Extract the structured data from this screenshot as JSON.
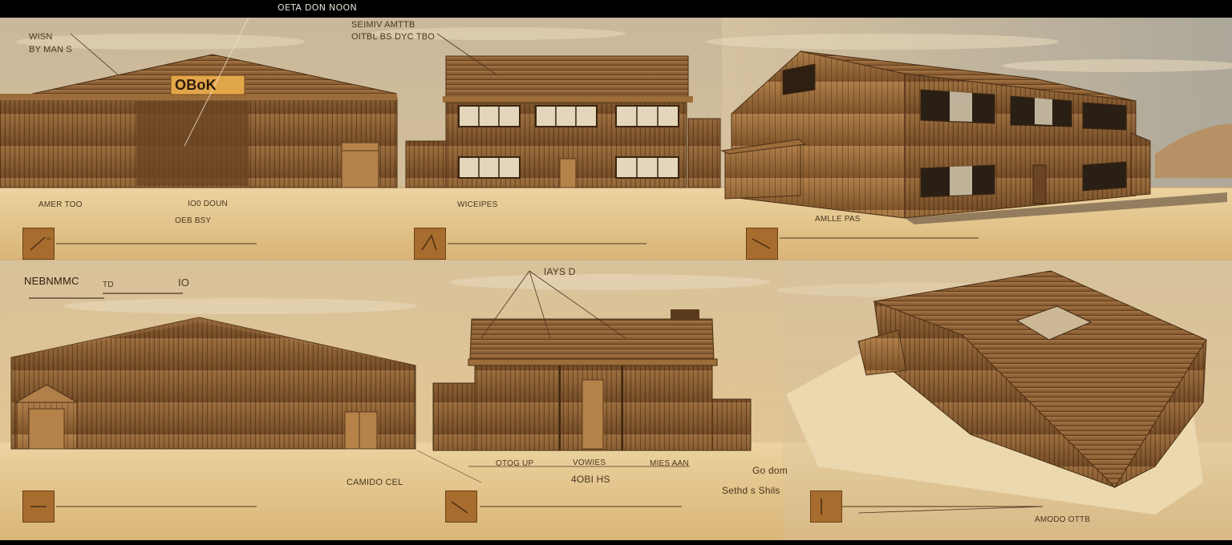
{
  "header": {
    "title": "OETA DON NOON"
  },
  "panels": [
    {
      "id": "top-left",
      "sign": "OBoK",
      "labels": [
        "WISN",
        "BY MAN S",
        "AMER TOO",
        "IO0 DOUN",
        "OEB BSY"
      ]
    },
    {
      "id": "top-center",
      "labels": [
        "SEIMIV AMTTB",
        "OITBL BS DYC TBO",
        "WICEIPES"
      ]
    },
    {
      "id": "top-right",
      "labels": [
        "AMLLE PAS"
      ]
    },
    {
      "id": "bottom-left",
      "labels": [
        "NEBNMMC",
        "TD",
        "IO",
        "CAMIDO CEL"
      ]
    },
    {
      "id": "bottom-center",
      "labels": [
        "IAYS D",
        "OTOG UP",
        "VOWIES",
        "MIES AAN",
        "4OBI HS"
      ]
    },
    {
      "id": "bottom-right",
      "labels": [
        "Go dom",
        "Sethd s Shils",
        "AMODO OTTB"
      ]
    }
  ],
  "colors": {
    "paper": "#e6c48a",
    "sky": "#d8c19a",
    "wood": "#8d6238",
    "wood_dark": "#5b3a1c",
    "tag": "#a66d2e"
  }
}
